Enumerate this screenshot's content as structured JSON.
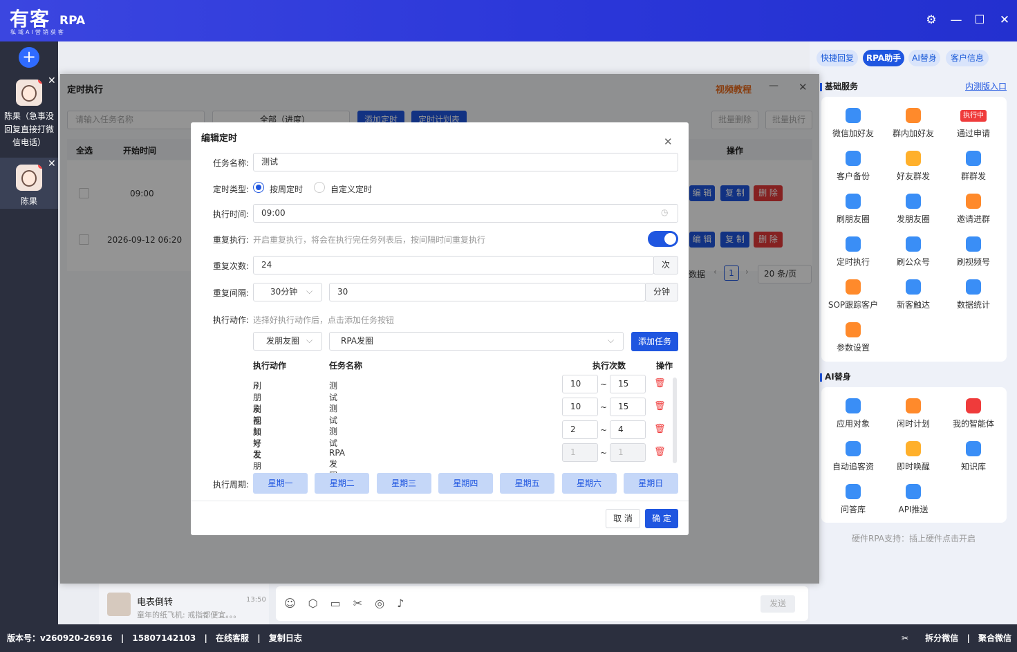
{
  "app": {
    "logo": "有客",
    "logo_rpa": "RPA",
    "logo_sub": "私域AI营销获客",
    "window_controls": [
      "settings-icon",
      "minimize-icon",
      "maximize-icon",
      "close-icon"
    ]
  },
  "contacts": [
    {
      "name": "陈果（急事没回复直接打微信电话）"
    },
    {
      "name": "陈果"
    }
  ],
  "footer": {
    "version": "版本号：v260920-26916",
    "phone": "15807142103",
    "service": "在线客服",
    "copy_log": "复制日志",
    "split": "拆分微信",
    "merge": "聚合微信"
  },
  "chat": {
    "name": "电表倒转",
    "time": "13:50",
    "preview": "童年的纸飞机: 戒指都便宜。。。",
    "send": "发送"
  },
  "right_panel": {
    "tabs": [
      "快捷回复",
      "RPA助手",
      "AI替身",
      "客户信息"
    ],
    "basic_title": "基础服务",
    "beta_link": "内测版入口",
    "running_badge": "执行中",
    "basic_items": [
      "微信加好友",
      "群内加好友",
      "通过申请",
      "客户备份",
      "好友群发",
      "群群发",
      "刷朋友圈",
      "发朋友圈",
      "邀请进群",
      "定时执行",
      "刷公众号",
      "刷视频号",
      "SOP跟踪客户",
      "新客触达",
      "数据统计",
      "参数设置"
    ],
    "ai_title": "AI替身",
    "ai_items": [
      "应用对象",
      "闲时计划",
      "我的智能体",
      "自动追客资",
      "即时唤醒",
      "知识库",
      "问答库",
      "API推送"
    ],
    "hardware": "硬件RPA支持：插上硬件点击开启"
  },
  "timer_window": {
    "title": "定时执行",
    "video": "视频教程",
    "search_placeholder": "请输入任务名称",
    "filter": "全部（进度）",
    "add_timer": "添加定时",
    "plan_list": "定时计划表",
    "batch_delete": "批量删除",
    "batch_run": "批量执行",
    "cols": {
      "select_all": "全选",
      "start_time": "开始时间",
      "ops": "操作"
    },
    "rows": [
      {
        "time": "09:00"
      },
      {
        "time": "2026-09-12 06:20"
      }
    ],
    "row_actions": [
      "编 辑",
      "复 制",
      "删 除"
    ],
    "data_tail": "数据",
    "page": "1",
    "page_size": "20 条/页"
  },
  "dialog": {
    "title": "编辑定时",
    "task_name_label": "任务名称:",
    "task_name": "测试",
    "timer_type_label": "定时类型:",
    "type_weekly": "按周定时",
    "type_custom": "自定义定时",
    "exec_time_label": "执行时间:",
    "exec_time": "09:00",
    "repeat_label": "重复执行:",
    "repeat_desc": "开启重复执行，将会在执行完任务列表后，按间隔时间重复执行",
    "repeat_count_label": "重复次数:",
    "repeat_count": "24",
    "count_unit": "次",
    "repeat_interval_label": "重复间隔:",
    "interval_select": "30分钟",
    "interval_value": "30",
    "interval_unit": "分钟",
    "action_label": "执行动作:",
    "action_desc": "选择好执行动作后，点击添加任务按钮",
    "action_select": "发朋友圈",
    "task_select": "RPA发圈",
    "add_task": "添加任务",
    "table_headers": {
      "action": "执行动作",
      "task": "任务名称",
      "count": "执行次数",
      "ops": "操作"
    },
    "tasks": [
      {
        "action": "刷朋友圈",
        "task": "测试",
        "min": "10",
        "max": "15"
      },
      {
        "action": "刷视频号",
        "task": "测试",
        "min": "10",
        "max": "15"
      },
      {
        "action": "加好友",
        "task": "测试",
        "min": "2",
        "max": "4"
      },
      {
        "action": "发朋友圈",
        "task": "RPA发圈",
        "min": "1",
        "max": "1"
      }
    ],
    "range_sep": "~",
    "cycle_label": "执行周期:",
    "days": [
      "星期一",
      "星期二",
      "星期三",
      "星期四",
      "星期五",
      "星期六",
      "星期日"
    ],
    "cancel": "取 消",
    "confirm": "确 定"
  }
}
